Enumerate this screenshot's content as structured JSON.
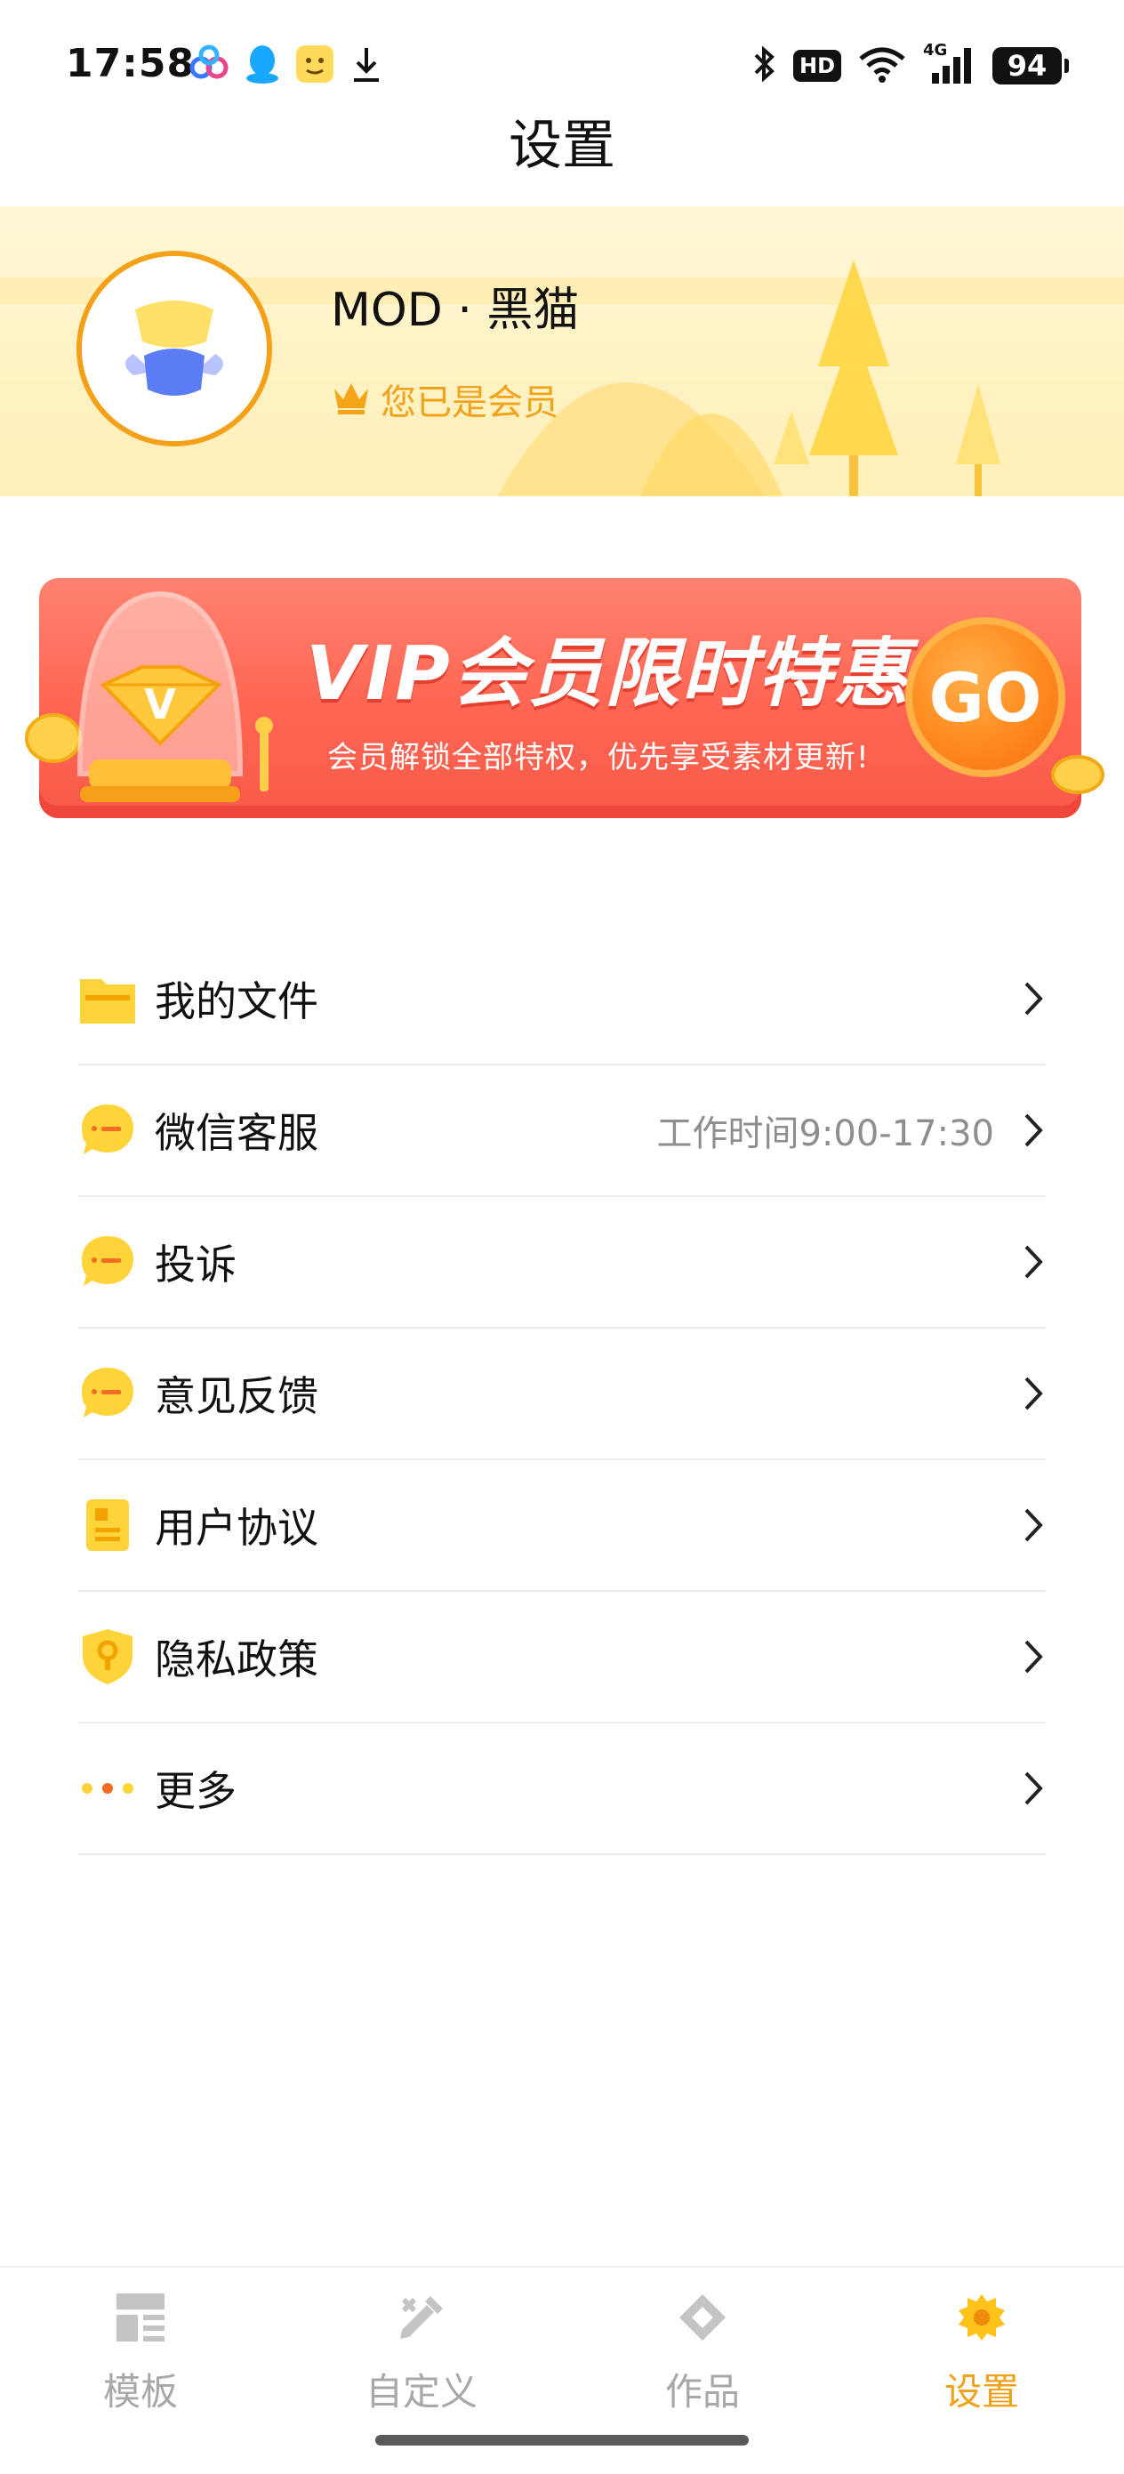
{
  "status_bar": {
    "time": "17:58",
    "left_icons": [
      "baidu-netdisk-icon",
      "qq-icon",
      "app-emoji-icon",
      "download-icon"
    ],
    "right_icons": [
      "bluetooth-icon",
      "hd-icon",
      "wifi-icon",
      "signal-4g-icon",
      "battery-icon"
    ],
    "hd_label": "HD",
    "network_label": "4G",
    "battery_level": "94"
  },
  "header": {
    "title": "设置"
  },
  "profile": {
    "name": "MOD · 黑猫",
    "member_status": "您已是会员"
  },
  "vip_promo": {
    "headline": "VIP会员限时特惠!",
    "subtext": "会员解锁全部特权，优先享受素材更新!",
    "go_label": "GO",
    "badge_letter": "V"
  },
  "menu": {
    "items": [
      {
        "label": "我的文件",
        "hint": "",
        "icon": "folder-icon"
      },
      {
        "label": "微信客服",
        "hint": "工作时间9:00-17:30",
        "icon": "chat-bubble-icon"
      },
      {
        "label": "投诉",
        "hint": "",
        "icon": "chat-bubble-icon"
      },
      {
        "label": "意见反馈",
        "hint": "",
        "icon": "chat-bubble-icon"
      },
      {
        "label": "用户协议",
        "hint": "",
        "icon": "document-icon"
      },
      {
        "label": "隐私政策",
        "hint": "",
        "icon": "shield-icon"
      },
      {
        "label": "更多",
        "hint": "",
        "icon": "more-dots-icon"
      }
    ]
  },
  "bottom_nav": {
    "tabs": [
      {
        "label": "模板",
        "icon": "template-icon",
        "active": false
      },
      {
        "label": "自定义",
        "icon": "customize-icon",
        "active": false
      },
      {
        "label": "作品",
        "icon": "works-icon",
        "active": false
      },
      {
        "label": "设置",
        "icon": "settings-gear-icon",
        "active": true
      }
    ]
  },
  "colors": {
    "accent": "#f0a21b",
    "promo_red": "#ff6552",
    "icon_yellow": "#ffd43b",
    "inactive_gray": "#a8a8a8"
  }
}
